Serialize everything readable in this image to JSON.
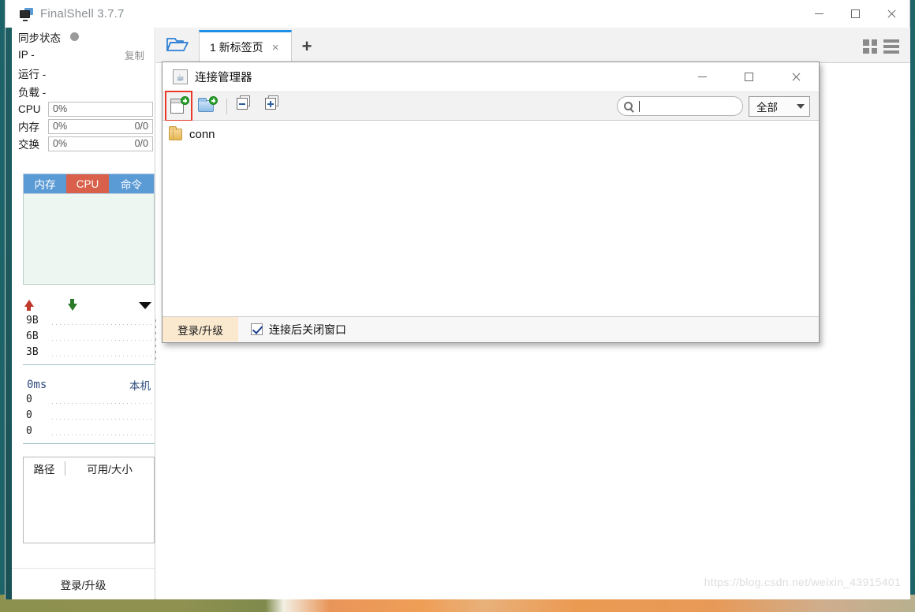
{
  "window": {
    "title": "FinalShell 3.7.7",
    "app_icon": "monitor-icon",
    "minimize": "—",
    "maximize": "□",
    "close": "✕"
  },
  "sidebar": {
    "sync_status_label": "同步状态",
    "ip_label": "IP  -",
    "copy_label": "复制",
    "uptime_label": "运行 -",
    "load_label": "负载 -",
    "meters": [
      {
        "name": "CPU",
        "value": "0%",
        "value2": ""
      },
      {
        "name": "内存",
        "value": "0%",
        "value2": "0/0"
      },
      {
        "name": "交换",
        "value": "0%",
        "value2": "0/0"
      }
    ],
    "tabs": [
      {
        "label": "内存",
        "active": false
      },
      {
        "label": "CPU",
        "active": true
      },
      {
        "label": "命令",
        "active": false
      }
    ],
    "network": {
      "upload_icon": "arrow-up-icon",
      "download_icon": "arrow-down-icon",
      "menu_icon": "caret-down-icon",
      "ticks": [
        "9B",
        "6B",
        "3B"
      ]
    },
    "latency": {
      "value": "0ms",
      "host": "本机",
      "ticks": [
        "0",
        "0",
        "0"
      ]
    },
    "disk": {
      "col_path": "路径",
      "col_avail": "可用/大小",
      "rows": []
    },
    "login_label": "登录/升级"
  },
  "content": {
    "open_folder_icon": "open-folder-icon",
    "tabs": [
      {
        "label": "1 新标签页",
        "close": "×",
        "active": true
      }
    ],
    "add_tab_label": "+",
    "view_grid_icon": "grid-view-icon",
    "view_list_icon": "list-view-icon"
  },
  "dialog": {
    "icon": "java-coffee-icon",
    "title": "连接管理器",
    "minimize": "—",
    "maximize": "□",
    "close": "✕",
    "toolbar": {
      "new_connection": "new-connection-icon",
      "new_folder": "new-folder-icon",
      "collapse_all": "collapse-all-icon",
      "expand_all": "expand-all-icon",
      "highlighted": "new-connection"
    },
    "search": {
      "icon": "search-icon",
      "value": "",
      "placeholder": ""
    },
    "filter": {
      "selected": "全部",
      "icon": "chevron-down-icon"
    },
    "tree": [
      {
        "label": "conn",
        "icon": "folder-icon"
      }
    ],
    "footer": {
      "login_label": "登录/升级",
      "checkbox_checked": true,
      "checkbox_label": "连接后关闭窗口"
    }
  },
  "watermark": "https://blog.csdn.net/weixin_43915401",
  "colors": {
    "teal_edge": "#1d5e63",
    "tab_blue": "#5b9bd5",
    "tab_red": "#d9604a",
    "tab_accent": "#1e90e8",
    "highlight_red": "#e8392a",
    "login_beige": "#fbe9cf"
  }
}
